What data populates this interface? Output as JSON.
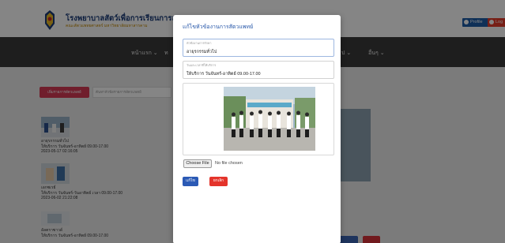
{
  "header": {
    "title": "โรงพยาบาลสัตว์เพื่อการเรียนการสอน",
    "subtitle": "คณะสัตวแพทยศาสตร์ มหาวิทยาลัยมหาสารคาม",
    "profile_label": "Profile",
    "logout_label": "Log"
  },
  "nav": {
    "home": "หน้าแรก ⌄",
    "item2": "ท",
    "item_right": "ป ⌄",
    "other": "อื่นๆ ⌄"
  },
  "background": {
    "action_button": "เพิ่มรายการสัตวแพทย์",
    "search_placeholder": "ค้นหาหัวข้อรายการสัตวแพทย์",
    "posts": [
      {
        "name": "อายุรกรรมทั่วไป",
        "schedule": "ให้บริการ วันจันทร์-อาทิตย์ 09.00-17.00",
        "date": "2023-05-17 02:16:05"
      },
      {
        "name": "เอกซเรย์",
        "schedule": "ให้บริการ วันจันทร์-วันอาทิตย์ เวลา 09.00-17.00",
        "date": "2023-06-02 21:22:08"
      },
      {
        "name": "อัลตราซาวด์",
        "schedule": "ให้บริการ วันจันทร์-อาทิตย์ 09.00-17.00"
      }
    ]
  },
  "modal": {
    "title": "แก้ไขหัวข้องานการสัตวแพทย์",
    "name_label": "หัวข้องานการรักษา",
    "name_value": "อายุรกรรมทั่วไป",
    "time_label": "วันและเวลาที่ให้บริการ",
    "time_value": "ให้บริการ วันจันทร์-อาทิตย์ 09.00-17.00",
    "file_button": "Choose File",
    "file_status": "No file chosen",
    "save_label": "แก้ไข",
    "cancel_label": "ยกเลิก"
  },
  "colors": {
    "header_bg": "#ffffff",
    "nav_bg": "#3a3a3a",
    "brand_blue": "#1c3d7a",
    "save_blue": "#2b5ab5",
    "cancel_red": "#e4342b",
    "action_pink": "#d63a55"
  }
}
